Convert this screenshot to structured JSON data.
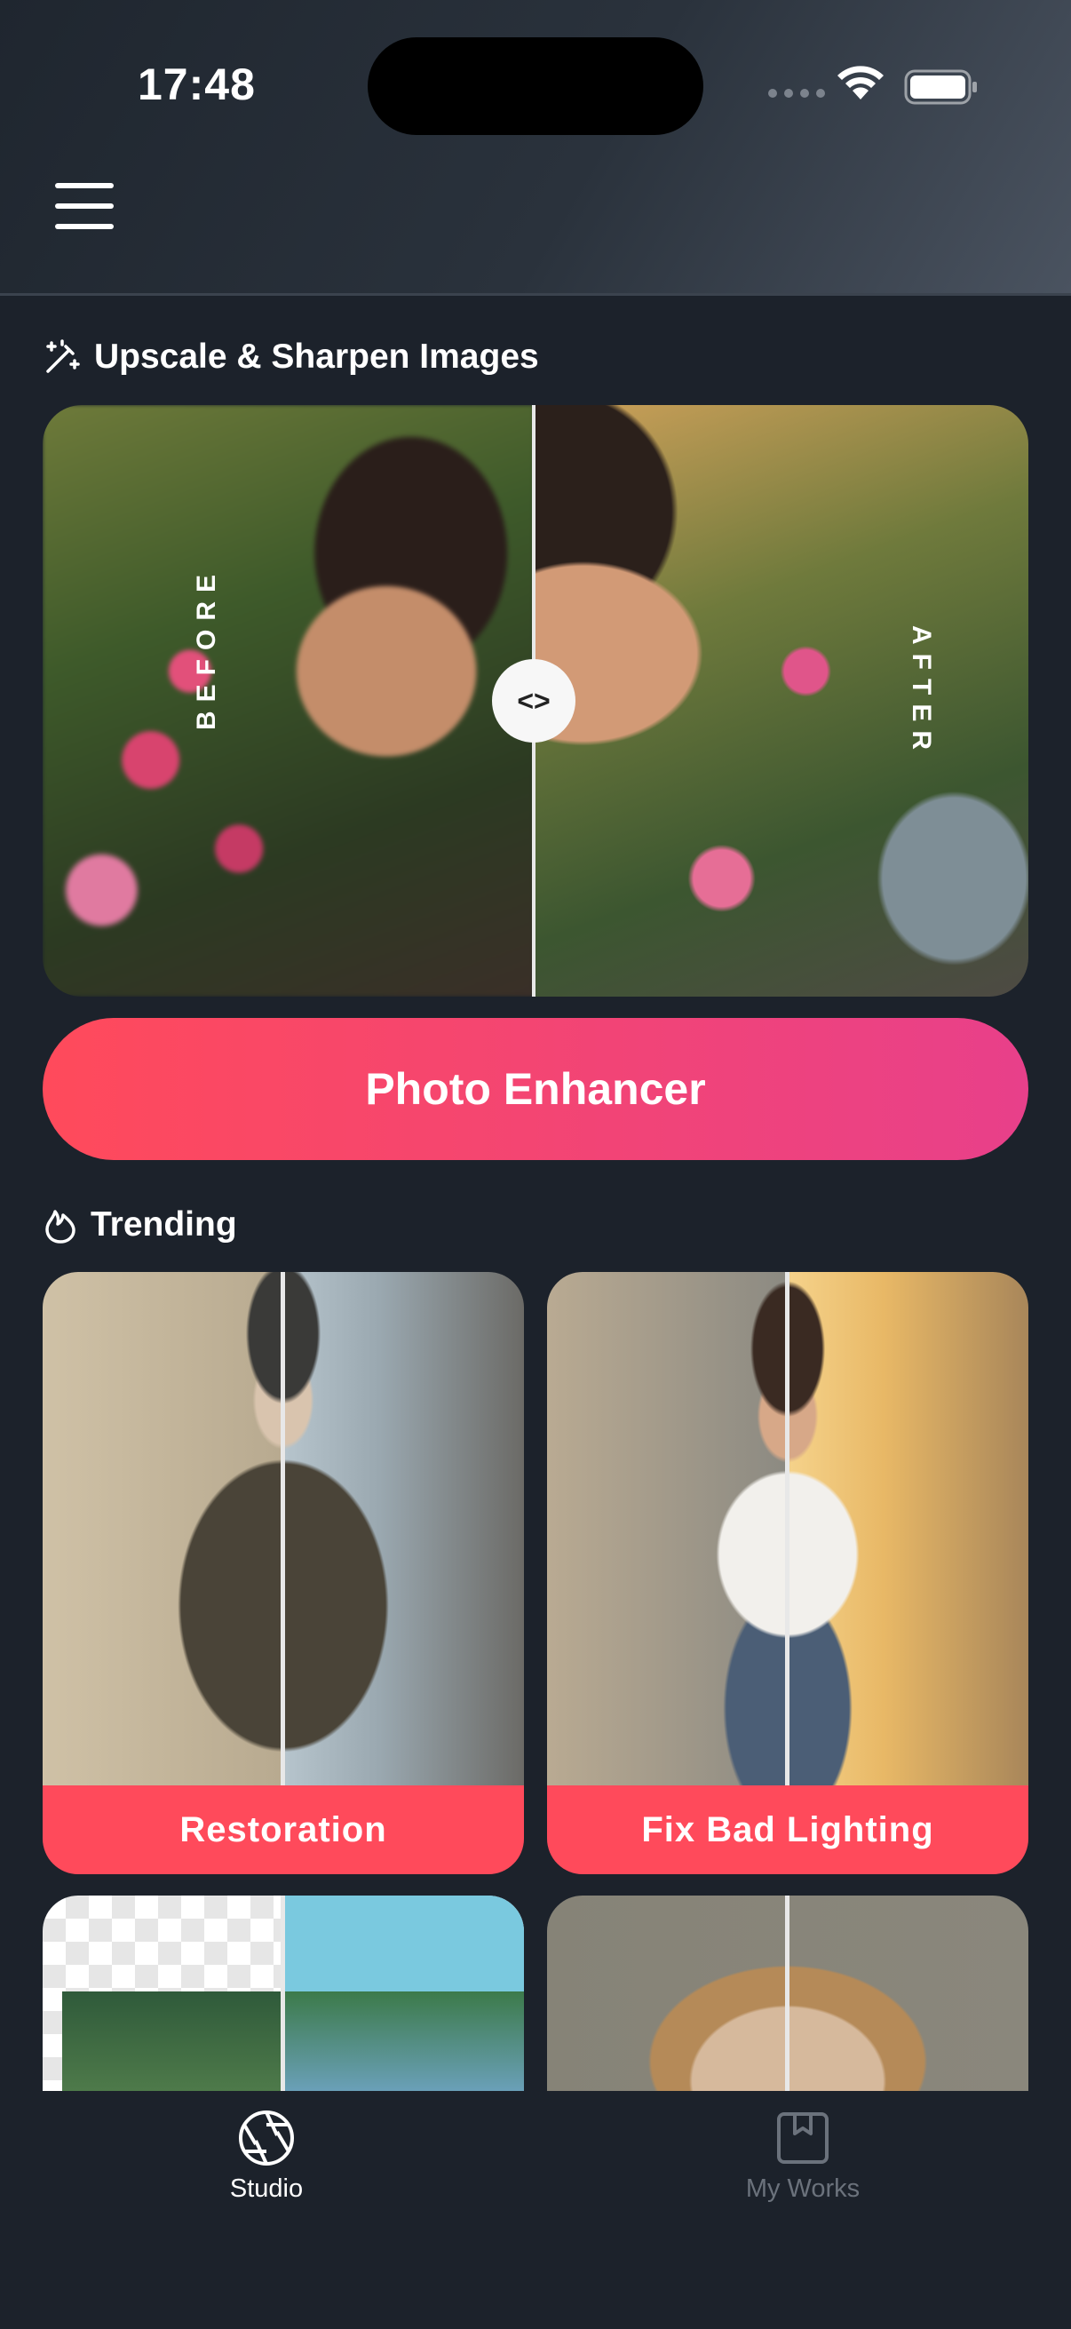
{
  "status_bar": {
    "time": "17:48"
  },
  "sections": {
    "upscale_title": "Upscale & Sharpen Images",
    "trending_title": "Trending"
  },
  "hero": {
    "before_label": "BEFORE",
    "after_label": "AFTER",
    "handle_glyph": "<>"
  },
  "cta": {
    "label": "Photo Enhancer"
  },
  "trending": [
    {
      "label": "Restoration"
    },
    {
      "label": "Fix Bad Lighting"
    }
  ],
  "tabbar": {
    "items": [
      {
        "label": "Studio",
        "active": true
      },
      {
        "label": "My Works",
        "active": false
      }
    ]
  },
  "colors": {
    "background": "#1c222b",
    "accent": "#ff4a5b",
    "accent_gradient_end": "#e8408a",
    "inactive_tab": "#6b727c"
  }
}
